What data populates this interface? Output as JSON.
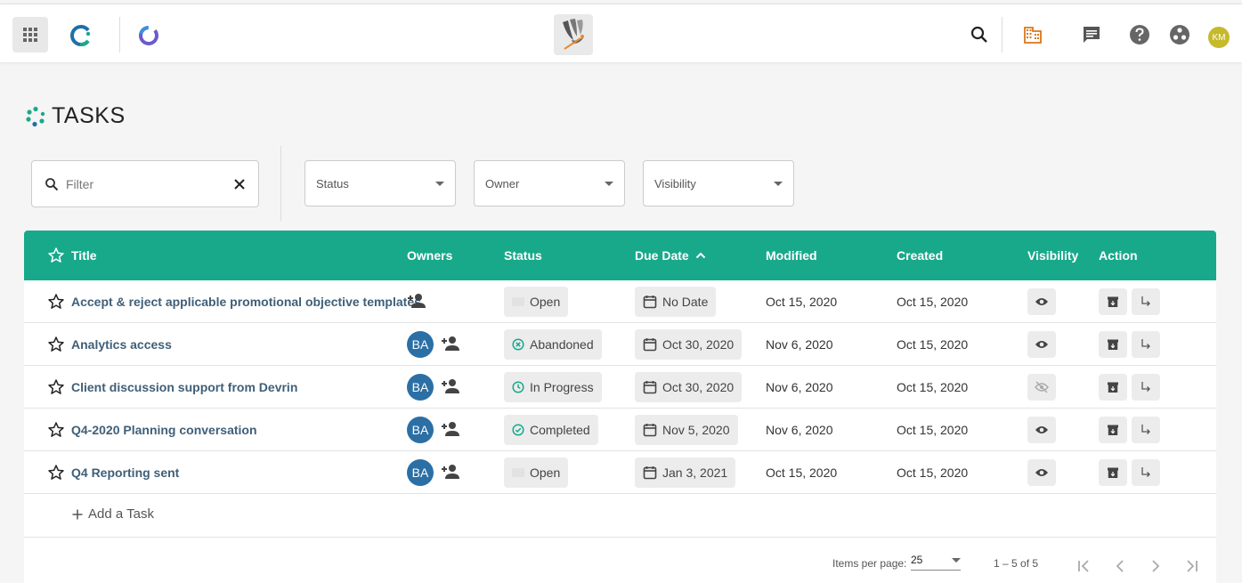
{
  "header": {
    "user_initials": "KM"
  },
  "page": {
    "title": "TASKS"
  },
  "filters": {
    "filter_placeholder": "Filter",
    "status_label": "Status",
    "owner_label": "Owner",
    "visibility_label": "Visibility"
  },
  "table": {
    "columns": {
      "title": "Title",
      "owners": "Owners",
      "status": "Status",
      "due_date": "Due Date",
      "modified": "Modified",
      "created": "Created",
      "visibility": "Visibility",
      "action": "Action"
    },
    "rows": [
      {
        "title": "Accept & reject applicable promotional objective templates",
        "owner": "",
        "status": "Open",
        "status_icon": "none",
        "due": "No Date",
        "modified": "Oct 15, 2020",
        "created": "Oct 15, 2020",
        "visibility": "visible"
      },
      {
        "title": "Analytics access",
        "owner": "BA",
        "status": "Abandoned",
        "status_icon": "x-circle-icon",
        "due": "Oct 30, 2020",
        "modified": "Nov 6, 2020",
        "created": "Oct 15, 2020",
        "visibility": "visible"
      },
      {
        "title": "Client discussion support from Devrin",
        "owner": "BA",
        "status": "In Progress",
        "status_icon": "clock-icon",
        "due": "Oct 30, 2020",
        "modified": "Nov 6, 2020",
        "created": "Oct 15, 2020",
        "visibility": "hidden"
      },
      {
        "title": "Q4-2020 Planning conversation",
        "owner": "BA",
        "status": "Completed",
        "status_icon": "check-circle-icon",
        "due": "Nov 5, 2020",
        "modified": "Nov 6, 2020",
        "created": "Oct 15, 2020",
        "visibility": "visible"
      },
      {
        "title": "Q4 Reporting sent",
        "owner": "BA",
        "status": "Open",
        "status_icon": "none",
        "due": "Jan 3, 2021",
        "modified": "Oct 15, 2020",
        "created": "Oct 15, 2020",
        "visibility": "visible"
      }
    ],
    "add_task_label": "Add a Task"
  },
  "paginator": {
    "items_per_page_label": "Items per page:",
    "items_per_page_value": "25",
    "range_label": "1 – 5 of 5"
  },
  "colors": {
    "header_teal": "#18a98b",
    "link": "#3f5f78",
    "avatar_blue": "#2b6fa5",
    "user_avatar": "#c6b92b"
  }
}
